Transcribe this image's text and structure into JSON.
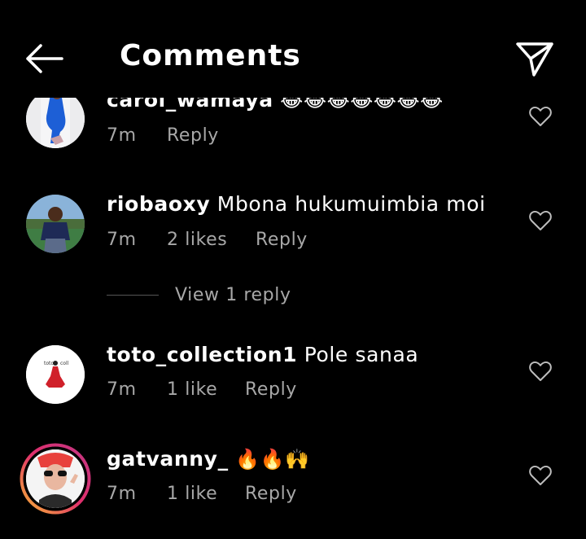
{
  "header": {
    "title": "Comments",
    "back_icon": "back-arrow-icon",
    "share_icon": "send-icon"
  },
  "comments": [
    {
      "username": "carol_wamaya",
      "text": "😂😂😂😂😂😂😂",
      "time": "7m",
      "likes": "",
      "reply_label": "Reply",
      "avatar_colors": [
        "#e8e8ea",
        "#1d5fd6"
      ]
    },
    {
      "username": "riobaoxy",
      "text": "Mbona hukumuimbia moi",
      "time": "7m",
      "likes": "2 likes",
      "reply_label": "Reply",
      "avatar_colors": [
        "#8ab3d9",
        "#2f6e3a"
      ]
    },
    {
      "username": "toto_collection1",
      "text": "Pole sanaa",
      "time": "7m",
      "likes": "1 like",
      "reply_label": "Reply",
      "avatar_colors": [
        "#ffffff",
        "#d0202a"
      ]
    },
    {
      "username": "gatvanny_",
      "text": "🔥🔥🙌",
      "time": "7m",
      "likes": "1 like",
      "reply_label": "Reply",
      "avatar_colors": [
        "#f4f4f4",
        "#e8413c"
      ]
    }
  ],
  "view_replies": "View 1 reply",
  "colors": {
    "background": "#000000",
    "text": "#ffffff",
    "secondary": "#a8a8a8",
    "story_ring": [
      "#f7b733",
      "#e1306c",
      "#c13584"
    ]
  }
}
